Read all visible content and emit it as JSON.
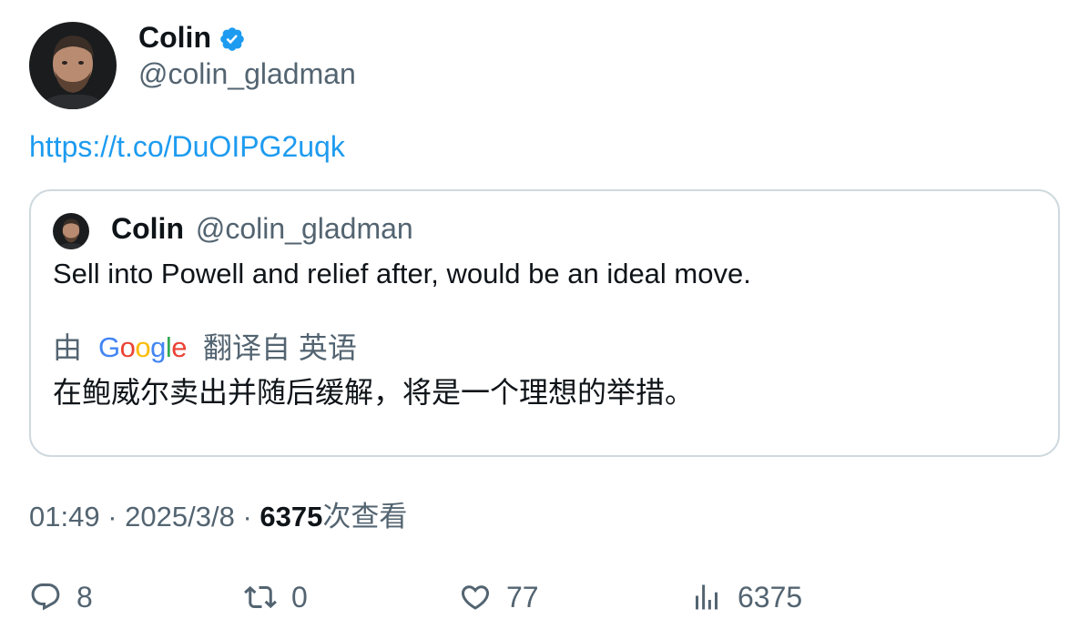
{
  "author": {
    "name": "Colin",
    "handle": "@colin_gladman",
    "verified_color": "#1d9bf0"
  },
  "tweet": {
    "link_text": "https://t.co/DuOIPG2uqk"
  },
  "quote": {
    "name": "Colin",
    "handle": "@colin_gladman",
    "text": "Sell into Powell and relief after, would be an ideal move.",
    "translate_prefix": "由",
    "translate_logo": [
      "G",
      "o",
      "o",
      "g",
      "l",
      "e"
    ],
    "translate_suffix": "翻译自 英语",
    "translated_text": "在鲍威尔卖出并随后缓解，将是一个理想的举措。"
  },
  "meta": {
    "time": "01:49",
    "separator": "·",
    "date": "2025/3/8",
    "views_count": "6375",
    "views_label": "次查看"
  },
  "actions": {
    "reply_count": "8",
    "retweet_count": "0",
    "like_count": "77",
    "views_count": "6375"
  },
  "colors": {
    "link": "#1d9bf0",
    "secondary_text": "#536471",
    "primary_text": "#0f1419",
    "border": "#cfd9de"
  }
}
